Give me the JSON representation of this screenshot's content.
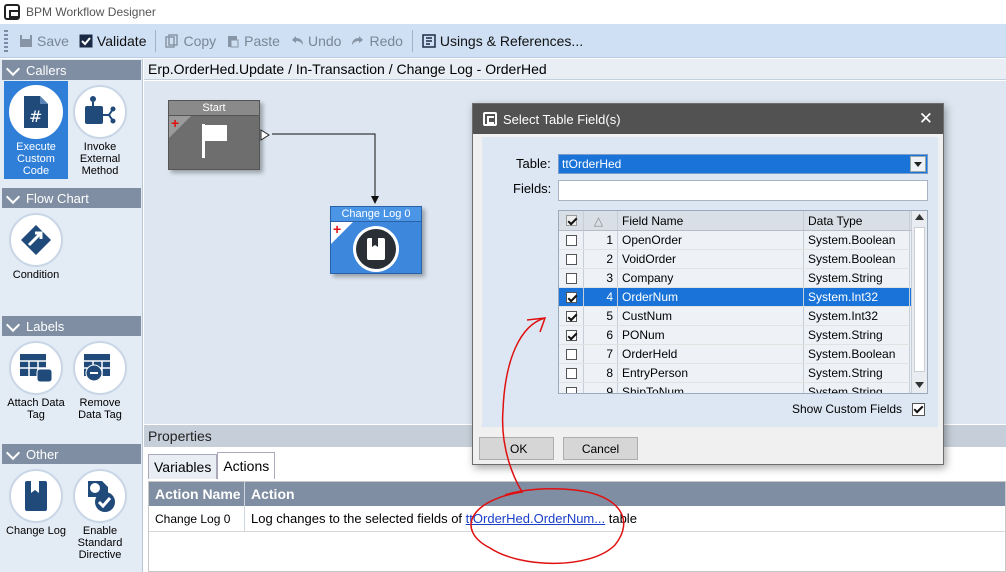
{
  "window": {
    "title": "BPM Workflow Designer"
  },
  "toolbar": {
    "save": "Save",
    "validate": "Validate",
    "copy": "Copy",
    "paste": "Paste",
    "undo": "Undo",
    "redo": "Redo",
    "usings": "Usings & References..."
  },
  "sidebar": {
    "callers": {
      "title": "Callers",
      "items": [
        {
          "label": "Execute Custom Code",
          "icon": "code-file-icon"
        },
        {
          "label": "Invoke External Method",
          "icon": "external-method-icon"
        }
      ]
    },
    "flowchart": {
      "title": "Flow Chart",
      "items": [
        {
          "label": "Condition",
          "icon": "condition-icon"
        }
      ]
    },
    "labels": {
      "title": "Labels",
      "items": [
        {
          "label": "Attach Data Tag",
          "icon": "attach-tag-icon"
        },
        {
          "label": "Remove Data Tag",
          "icon": "remove-tag-icon"
        }
      ]
    },
    "other": {
      "title": "Other",
      "items": [
        {
          "label": "Change Log",
          "icon": "book-icon"
        },
        {
          "label": "Enable Standard Directive",
          "icon": "enable-directive-icon"
        }
      ]
    }
  },
  "canvas": {
    "breadcrumb": "Erp.OrderHed.Update / In-Transaction / Change Log - OrderHed",
    "start_node": "Start",
    "changelog_node": "Change Log 0"
  },
  "properties": {
    "title": "Properties",
    "tabs": [
      "Variables",
      "Actions"
    ],
    "active_tab": "Actions",
    "columns": [
      "Action Name",
      "Action"
    ],
    "row": {
      "name": "Change Log 0",
      "action_prefix": "Log changes to the selected fields of",
      "action_link": "ttOrderHed.OrderNum...",
      "action_suffix": "table"
    }
  },
  "dialog": {
    "title": "Select Table Field(s)",
    "table_label": "Table:",
    "table_value": "ttOrderHed",
    "fields_label": "Fields:",
    "fields_value": "",
    "columns": [
      "",
      "",
      "Field Name",
      "Data Type"
    ],
    "rows": [
      {
        "n": "1",
        "name": "OpenOrder",
        "type": "System.Boolean",
        "checked": false
      },
      {
        "n": "2",
        "name": "VoidOrder",
        "type": "System.Boolean",
        "checked": false
      },
      {
        "n": "3",
        "name": "Company",
        "type": "System.String",
        "checked": false
      },
      {
        "n": "4",
        "name": "OrderNum",
        "type": "System.Int32",
        "checked": true
      },
      {
        "n": "5",
        "name": "CustNum",
        "type": "System.Int32",
        "checked": true
      },
      {
        "n": "6",
        "name": "PONum",
        "type": "System.String",
        "checked": true
      },
      {
        "n": "7",
        "name": "OrderHeld",
        "type": "System.Boolean",
        "checked": false
      },
      {
        "n": "8",
        "name": "EntryPerson",
        "type": "System.String",
        "checked": false
      },
      {
        "n": "9",
        "name": "ShipToNum",
        "type": "System.String",
        "checked": false
      }
    ],
    "highlighted_row": "4",
    "show_custom_label": "Show Custom Fields",
    "ok": "OK",
    "cancel": "Cancel"
  },
  "colors": {
    "accent": "#1a73d8",
    "annotation": "#e01010"
  }
}
